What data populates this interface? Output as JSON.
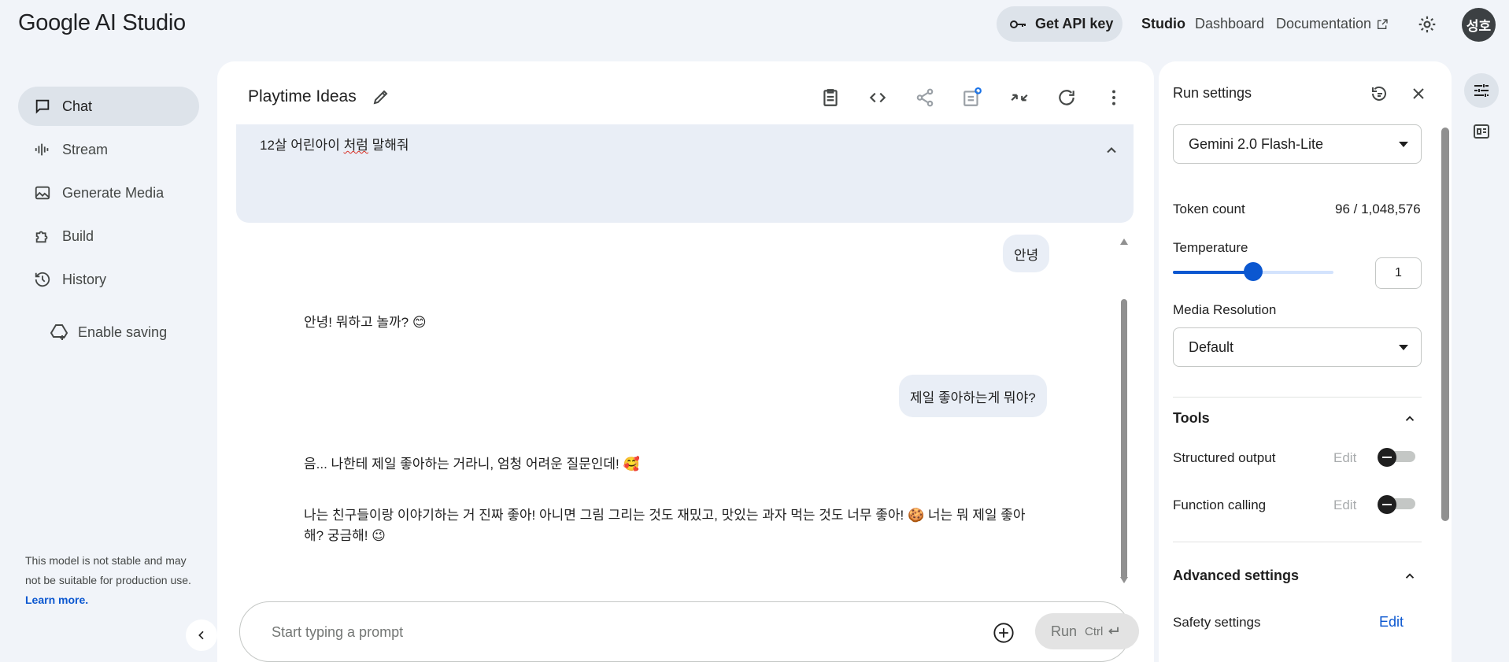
{
  "header": {
    "logo": "Google AI Studio",
    "api_key_label": "Get API key",
    "nav": {
      "studio": "Studio",
      "dashboard": "Dashboard",
      "documentation": "Documentation"
    },
    "avatar_initials": "성호"
  },
  "sidebar": {
    "items": [
      {
        "label": "Chat",
        "icon": "chat-icon",
        "active": true
      },
      {
        "label": "Stream",
        "icon": "stream-icon",
        "active": false
      },
      {
        "label": "Generate Media",
        "icon": "media-icon",
        "active": false
      },
      {
        "label": "Build",
        "icon": "build-icon",
        "active": false
      },
      {
        "label": "History",
        "icon": "history-icon",
        "active": false
      }
    ],
    "enable_saving": "Enable saving",
    "note": "This model is not stable and may not be suitable for production use.",
    "note_link": "Learn more."
  },
  "chat": {
    "title": "Playtime Ideas",
    "system_instruction": {
      "before": "12살 어린아이 ",
      "underlined": "처럼",
      "after": " 말해줘"
    },
    "messages": [
      {
        "role": "user",
        "text": "안녕"
      },
      {
        "role": "model",
        "text": "안녕! 뭐하고 놀까? 😊"
      },
      {
        "role": "user",
        "text": "제일 좋아하는게 뭐야?"
      },
      {
        "role": "model",
        "text": "음... 나한테 제일 좋아하는 거라니, 엄청 어려운 질문인데! 🥰"
      },
      {
        "role": "model",
        "text_line1": "나는 친구들이랑 이야기하는 거 진짜 좋아! 아니면 그림 그리는 것도 재밌고, 맛있는 과자 먹는 것도 너무 좋아! 🍪 너는 뭐 제일 좋아",
        "text_line2": "해? 궁금해! 😉"
      }
    ],
    "prompt_placeholder": "Start typing a prompt",
    "run_label": "Run",
    "run_shortcut": "Ctrl"
  },
  "run_settings": {
    "title": "Run settings",
    "model": "Gemini 2.0 Flash-Lite",
    "token_count_label": "Token count",
    "token_count_value": "96 / 1,048,576",
    "temperature_label": "Temperature",
    "temperature_value": "1",
    "temperature_fraction": 0.5,
    "media_resolution_label": "Media Resolution",
    "media_resolution_value": "Default",
    "tools_title": "Tools",
    "structured_output_label": "Structured output",
    "function_calling_label": "Function calling",
    "edit_label": "Edit",
    "advanced_title": "Advanced settings",
    "safety_label": "Safety settings",
    "safety_edit": "Edit"
  },
  "colors": {
    "accent": "#0b57d0",
    "panel_bg": "#f1f4f9",
    "bubble": "#e9eef6"
  }
}
